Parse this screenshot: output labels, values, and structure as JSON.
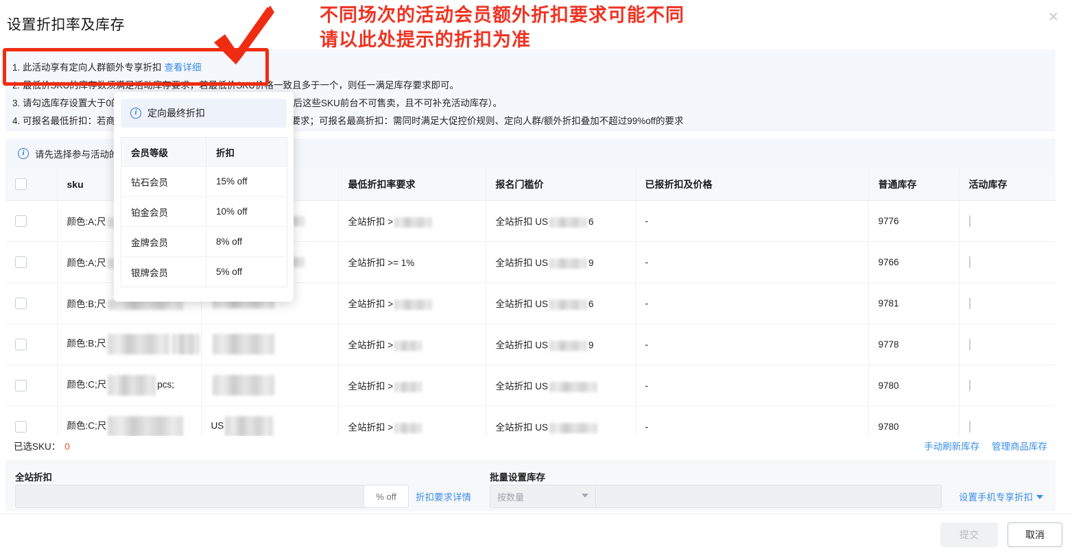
{
  "dialog": {
    "title": "设置折扣率及库存",
    "close_icon": "close-icon"
  },
  "annotation": {
    "line1": "不同场次的活动会员额外折扣要求可能不同",
    "line2": "请以此处提示的折扣为准",
    "color": "#ee3322"
  },
  "notice": {
    "items": [
      {
        "text": "1. 此活动享有定向人群额外专享折扣",
        "link": "查看详细"
      },
      {
        "text": "2. 最低价SKU的库存数须满足活动库存要求，若最低价SKU价格一致且多于一个，则任一满足库存要求即可。",
        "link": ""
      },
      {
        "text": "3. 请勾选库存设置大于0的SKU，库存为0的SKU不要选中（活动开始后这些SKU前台不可售卖，且不可补充活动库存）。",
        "link": ""
      },
      {
        "text": "4. 可报名最低折扣：若商品命中多条大促控价规则，需满足其中最高要求；可报名最高折扣：需同时满足大促控价规则、定向人群/额外折扣叠加不超过99%off的要求",
        "link": ""
      }
    ]
  },
  "info_strip": {
    "icon": "info-circle-icon",
    "text": "请先选择参与活动的SKU"
  },
  "popover": {
    "icon": "info-circle-icon",
    "title": "定向最终折扣",
    "columns": [
      "会员等级",
      "折扣"
    ],
    "rows": [
      {
        "level": "钻石会员",
        "discount": "15% off"
      },
      {
        "level": "铂金会员",
        "discount": "10% off"
      },
      {
        "level": "金牌会员",
        "discount": "8% off"
      },
      {
        "level": "银牌会员",
        "discount": "5% off"
      }
    ]
  },
  "table": {
    "columns": [
      "",
      "sku",
      "",
      "最低折扣率要求",
      "报名门槛价",
      "已报折扣及价格",
      "普通库存",
      "活动库存"
    ],
    "rows": [
      {
        "sku": "颜色:A;尺",
        "attr": "",
        "min_discount": "全站折扣 >",
        "gate_price": "全站折扣 US",
        "gate_price_tail": "6",
        "applied": "-",
        "normal_stock": "9776",
        "activity_stock": ""
      },
      {
        "sku": "颜色:A;尺",
        "attr": "",
        "min_discount": "全站折扣 >= 1%",
        "gate_price": "全站折扣 US",
        "gate_price_tail": "9",
        "applied": "-",
        "normal_stock": "9766",
        "activity_stock": ""
      },
      {
        "sku": "颜色:B;尺",
        "attr": "",
        "min_discount": "全站折扣 >",
        "gate_price": "全站折扣 US",
        "gate_price_tail": "6",
        "applied": "-",
        "normal_stock": "9781",
        "activity_stock": ""
      },
      {
        "sku": "颜色:B;尺",
        "attr": "",
        "min_discount": "全站折扣 >",
        "gate_price": "全站折扣 US",
        "gate_price_tail": "9",
        "applied": "-",
        "normal_stock": "9778",
        "activity_stock": ""
      },
      {
        "sku": "颜色:C;尺",
        "attr": "",
        "min_discount": "全站折扣 >",
        "gate_price": "全站折扣 US",
        "gate_price_tail": "",
        "applied": "-",
        "normal_stock": "9780",
        "activity_stock": ""
      },
      {
        "sku": "颜色:C;尺",
        "attr": "US",
        "min_discount": "全站折扣 >",
        "gate_price": "全站折扣 US",
        "gate_price_tail": "",
        "applied": "-",
        "normal_stock": "9780",
        "activity_stock": ""
      }
    ]
  },
  "selected_bar": {
    "label": "已选SKU：",
    "count": "0",
    "count_color": "#e8502f",
    "links": [
      "手动刷新库存",
      "管理商品库存"
    ]
  },
  "bulk": {
    "discount_label": "全站折扣",
    "discount_value": "",
    "discount_suffix": "% off",
    "discount_detail_link": "折扣要求详情",
    "stock_label": "批量设置库存",
    "stock_mode_placeholder": "按数量",
    "stock_value": "",
    "phone_discount_link": "设置手机专享折扣"
  },
  "footer": {
    "submit_label": "提交",
    "cancel_label": "取消"
  }
}
